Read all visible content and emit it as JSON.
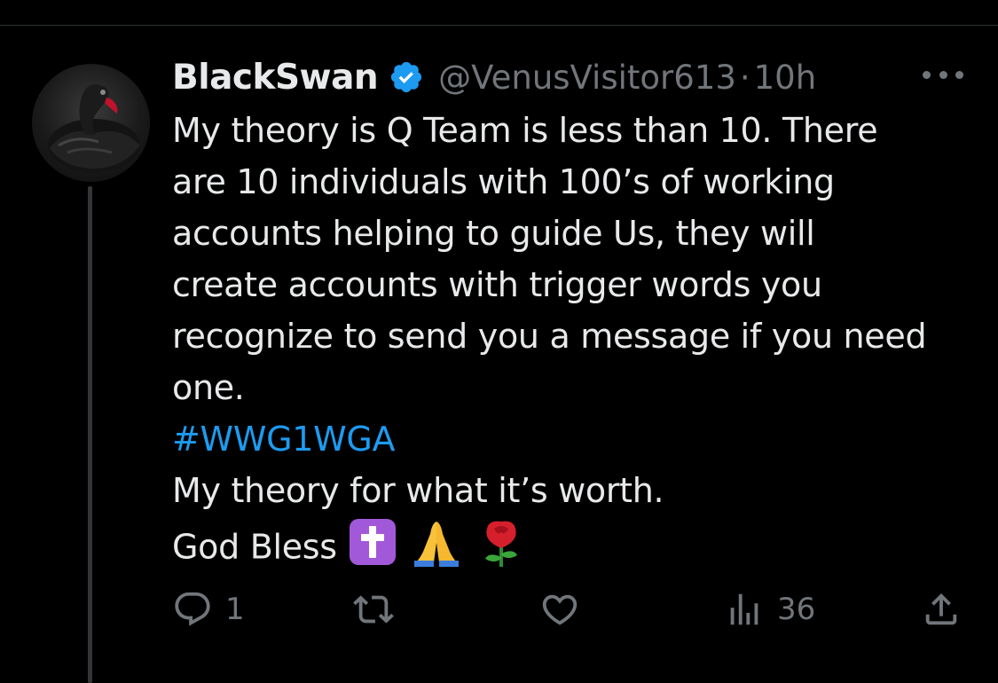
{
  "tweet": {
    "display_name": "BlackSwan",
    "handle": "@VenusVisitor613",
    "separator": "·",
    "time": "10h",
    "lines": [
      "My theory is Q Team is less than 10. There",
      "are 10 individuals with 100’s of working",
      "accounts helping to guide Us, they will",
      "create accounts with trigger words you",
      "recognize to send you a message if you need",
      "one."
    ],
    "hashtag": "#WWG1WGA",
    "line_after_hashtag": "My theory for what it’s worth.",
    "closing_text": "God Bless"
  },
  "actions": {
    "reply_count": "1",
    "views_count": "36"
  },
  "icons": {
    "avatar": "black-swan-avatar",
    "verified": "verified-badge-icon",
    "more": "more-icon",
    "reply": "reply-icon",
    "retweet": "retweet-icon",
    "like": "like-icon",
    "views": "views-icon",
    "share": "share-icon",
    "emojis": [
      "latin-cross-emoji",
      "folded-hands-emoji",
      "rose-emoji"
    ]
  },
  "colors": {
    "background": "#000000",
    "text": "#e7e9ea",
    "muted": "#71767b",
    "accent": "#1d9bf0"
  }
}
